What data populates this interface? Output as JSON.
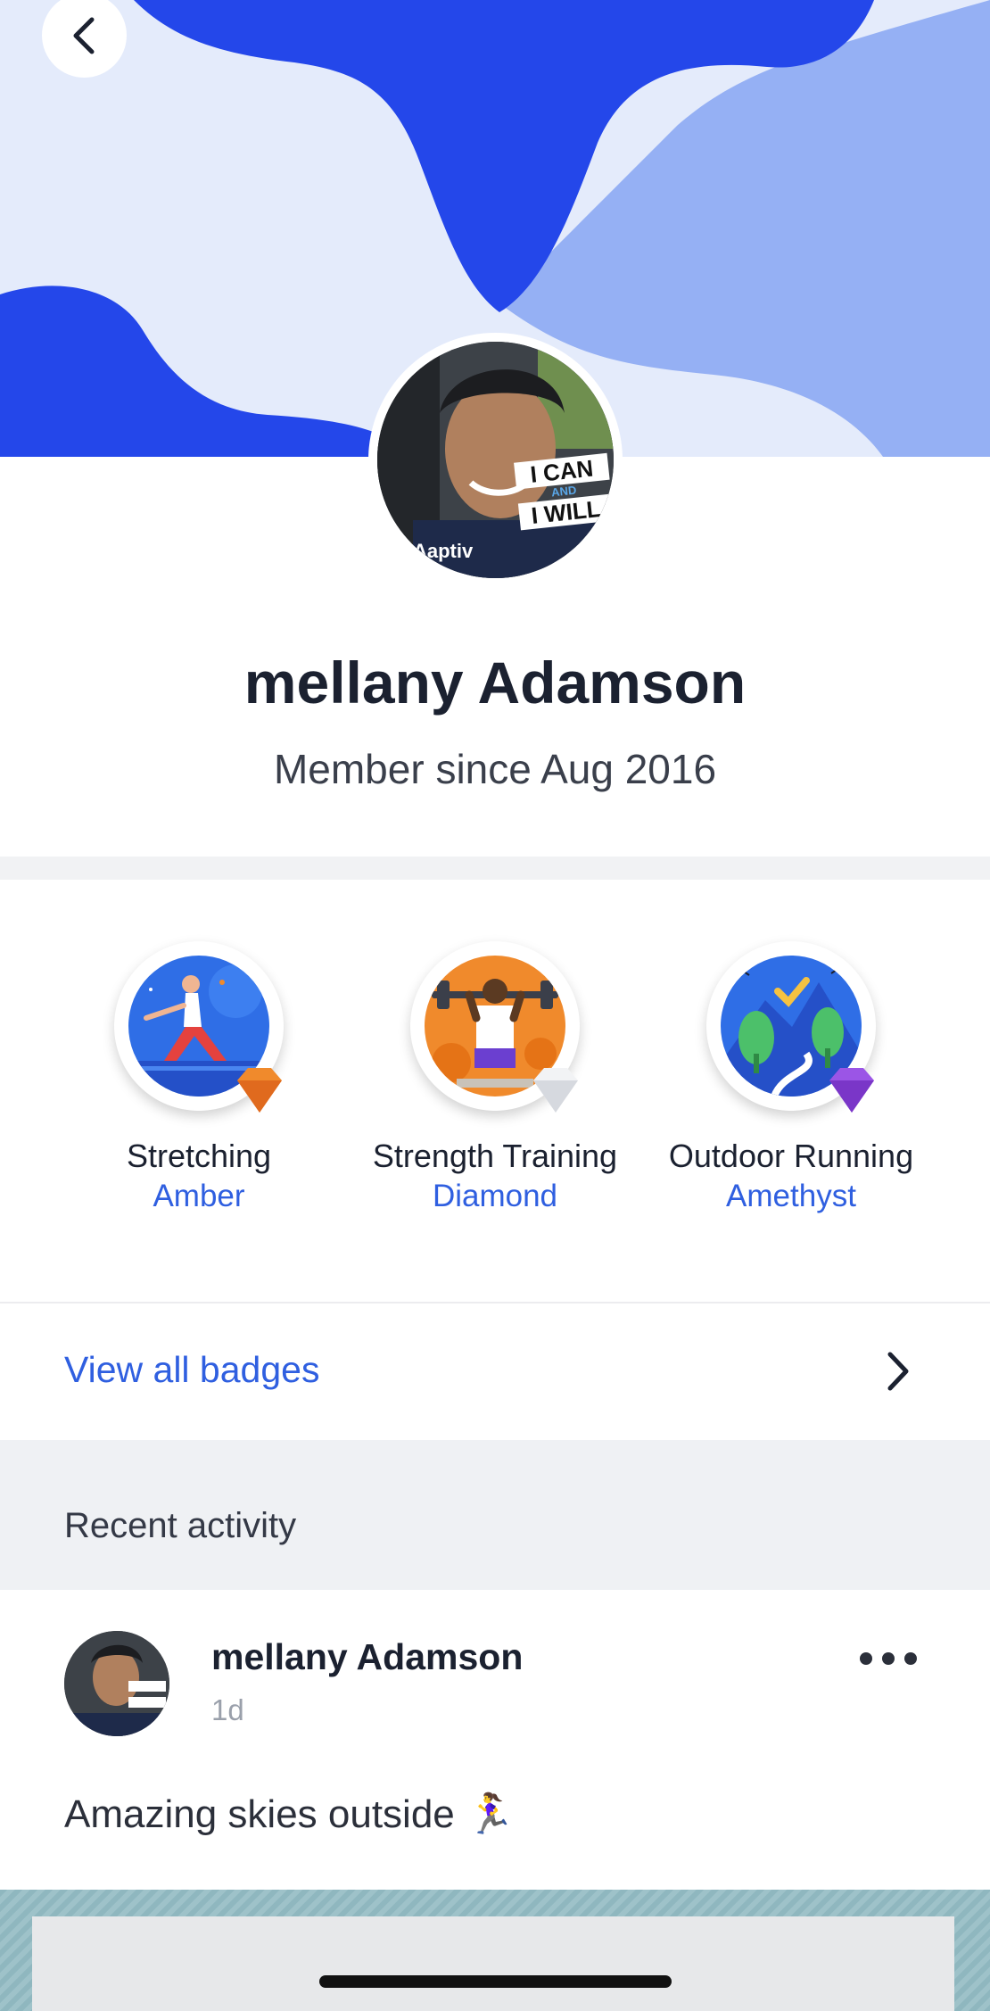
{
  "header": {
    "back_icon": "chevron-left-icon",
    "colors": {
      "dark_wave": "#2447ea",
      "light_wave": "#95b0f4",
      "background": "#e4ebfb"
    }
  },
  "avatar_overlay": {
    "line1": "I CAN",
    "line2": "AND",
    "line3": "I WILL",
    "brand": "Aaptiv"
  },
  "profile": {
    "name": "mellany Adamson",
    "member_since": "Member since Aug 2016"
  },
  "badges": [
    {
      "label": "Stretching",
      "tier": "Amber",
      "icon": "stretching-badge-icon",
      "gem_color": "#f08a2c"
    },
    {
      "label": "Strength Training",
      "tier": "Diamond",
      "icon": "strength-training-badge-icon",
      "gem_color": "#e6e8ec"
    },
    {
      "label": "Outdoor Running",
      "tier": "Amethyst",
      "icon": "outdoor-running-badge-icon",
      "gem_color": "#8a3fd8"
    }
  ],
  "view_all": {
    "label": "View all badges",
    "icon": "chevron-right-icon"
  },
  "recent_activity": {
    "label": "Recent activity"
  },
  "post": {
    "author": "mellany Adamson",
    "time": "1d",
    "text": "Amazing skies outside 🏃‍♀️",
    "more_icon": "more-horizontal-icon"
  },
  "accent_color": "#2f5fe0"
}
